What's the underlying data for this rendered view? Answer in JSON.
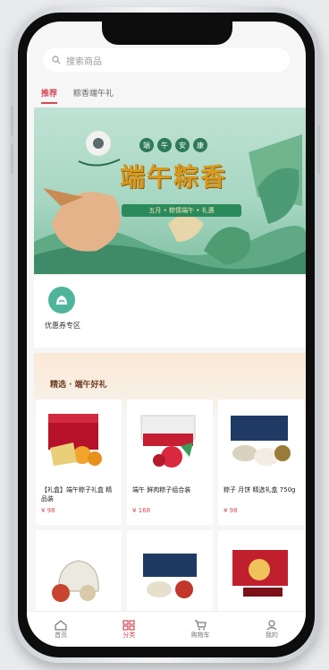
{
  "search": {
    "placeholder": "搜索商品"
  },
  "tabs": [
    {
      "label": "推荐"
    },
    {
      "label": "粽香端午礼"
    }
  ],
  "banner": {
    "badges": [
      "端",
      "午",
      "安",
      "康"
    ],
    "title": "端午粽香",
    "ribbon": "五月 • 粽情端午 • 礼遇"
  },
  "quick": {
    "label": "优惠券专区"
  },
  "recommend": {
    "title": "精选 · 端午好礼"
  },
  "products": [
    {
      "name": "【礼盒】端午粽子礼盒 精品装",
      "price": "¥ 98"
    },
    {
      "name": "端午 鲜肉粽子组合装",
      "price": "¥ 168"
    },
    {
      "name": "粽子 月饼 精选礼盒 750g",
      "price": "¥ 98"
    },
    {
      "name": "",
      "price": ""
    },
    {
      "name": "",
      "price": ""
    },
    {
      "name": "",
      "price": ""
    }
  ],
  "tabbar": [
    {
      "label": "首页",
      "icon": "home-icon"
    },
    {
      "label": "分类",
      "icon": "category-icon"
    },
    {
      "label": "购物车",
      "icon": "cart-icon"
    },
    {
      "label": "我的",
      "icon": "user-icon"
    }
  ],
  "colors": {
    "accent": "#d04a55",
    "quick_icon": "#4fb59a",
    "banner_green": "#2b8a5c"
  }
}
